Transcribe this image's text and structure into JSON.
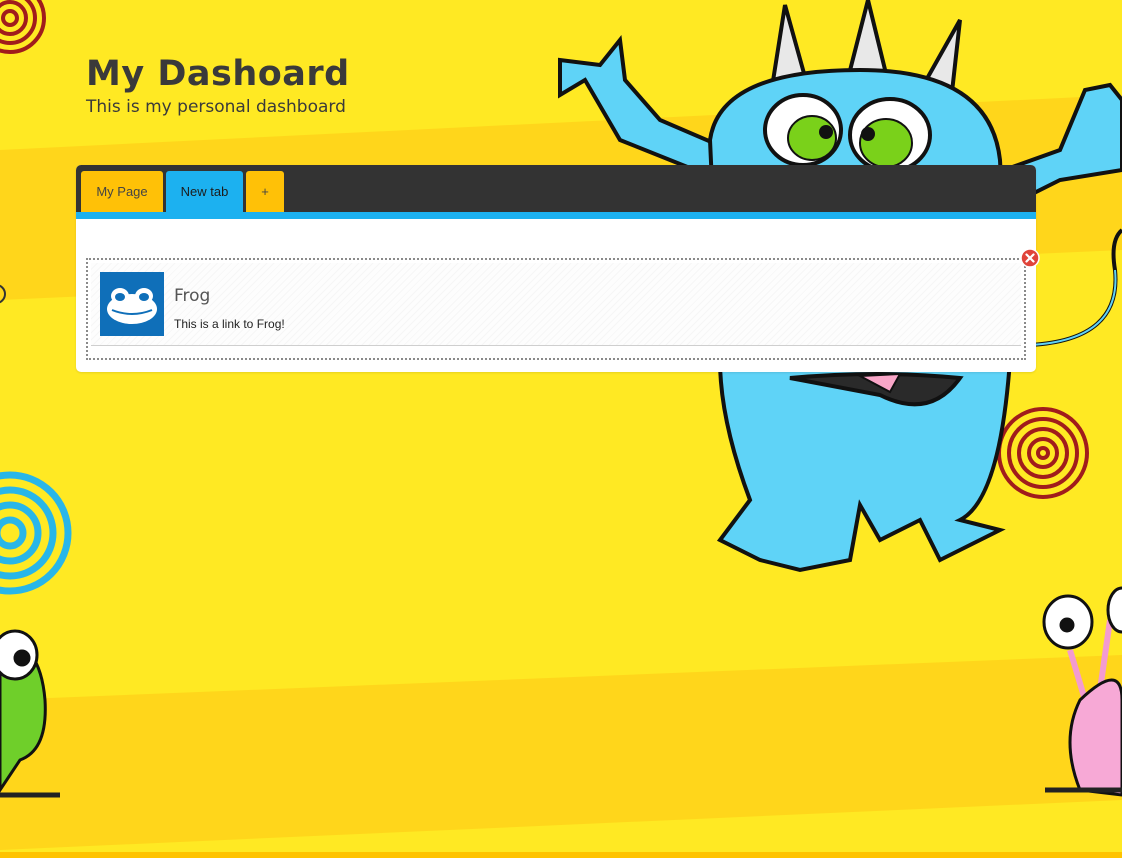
{
  "header": {
    "title": "My Dashoard",
    "subtitle": "This is my personal dashboard"
  },
  "tabs": [
    {
      "label": "My Page",
      "color": "#ffc107"
    },
    {
      "label": "New tab",
      "color": "#1cb1f0",
      "active": true
    },
    {
      "label": "+",
      "color": "#ffc107"
    }
  ],
  "widget": {
    "title": "Frog",
    "description": "This is a link to Frog!",
    "logo_icon": "frog-logo-icon",
    "close_icon": "close-icon"
  },
  "colors": {
    "background": "#ffe923",
    "tabbar": "#333333",
    "accent_blue": "#1cb1f0",
    "accent_yellow": "#ffc107",
    "monster_blue": "#5fd3f7"
  }
}
